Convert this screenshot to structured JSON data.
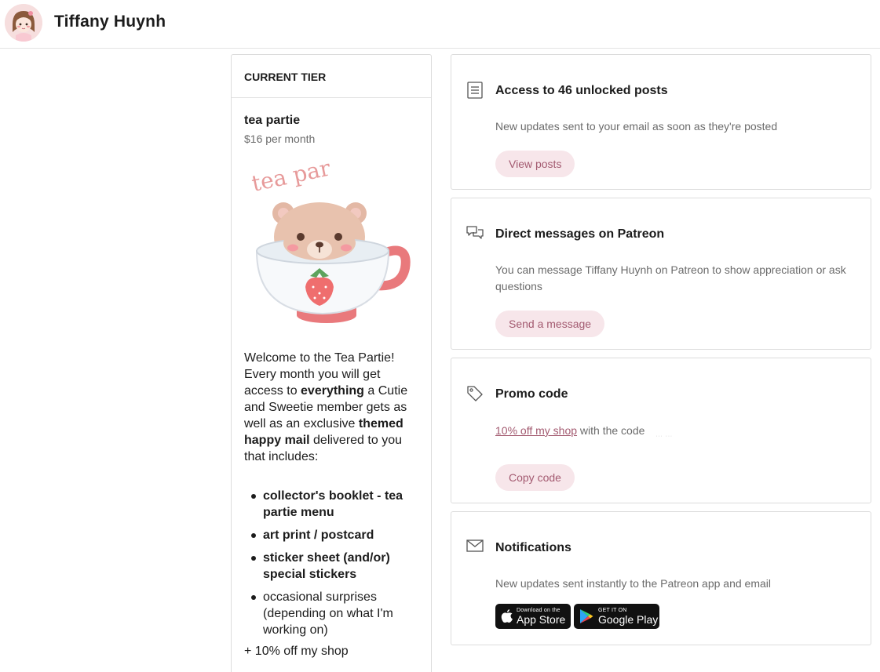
{
  "header": {
    "creator_name": "Tiffany Huynh",
    "avatar_icon": "creator-avatar-icon"
  },
  "tier": {
    "section_label": "CURRENT TIER",
    "name": "tea partie",
    "price": "$16 per month",
    "image_icon": "tea-cup-bear-illustration",
    "image_text": "tea par",
    "description": {
      "part1": "Welcome to the Tea Partie! Every month you will get access to ",
      "bold1": "everything",
      "part2": " a Cutie and Sweetie member gets as well as an exclusive ",
      "bold2": "themed happy mail",
      "part3": " delivered to you that includes:"
    },
    "items": [
      "collector's booklet - tea partie menu",
      "art print / postcard",
      "sticker sheet (and/or) special stickers",
      "occasional surprises (depending on what I'm working on)"
    ],
    "extra": "+ 10% off my shop"
  },
  "benefits": {
    "posts": {
      "icon": "document-icon",
      "title": "Access to 46 unlocked posts",
      "text": "New updates sent to your email as soon as they're posted",
      "button": "View posts"
    },
    "messages": {
      "icon": "chat-bubbles-icon",
      "title": "Direct messages on Patreon",
      "text": "You can message Tiffany Huynh on Patreon to show appreciation or ask questions",
      "button": "Send a message"
    },
    "promo": {
      "icon": "tag-icon",
      "title": "Promo code",
      "link_text": "10% off my shop",
      "text_after": "with the code",
      "code_hidden": "ᐧᐧᐧ ᐧᐧᐧ",
      "button": "Copy code"
    },
    "notifications": {
      "icon": "envelope-icon",
      "title": "Notifications",
      "text": "New updates sent instantly to the Patreon app and email",
      "app_store": {
        "small": "Download on the",
        "big": "App Store"
      },
      "google_play": {
        "small": "GET IT ON",
        "big": "Google Play"
      }
    }
  },
  "colors": {
    "accent_text": "#a35a70",
    "pill_bg": "#f7e6ea",
    "border": "#dcdcdc",
    "muted_text": "#6b6b6b"
  }
}
